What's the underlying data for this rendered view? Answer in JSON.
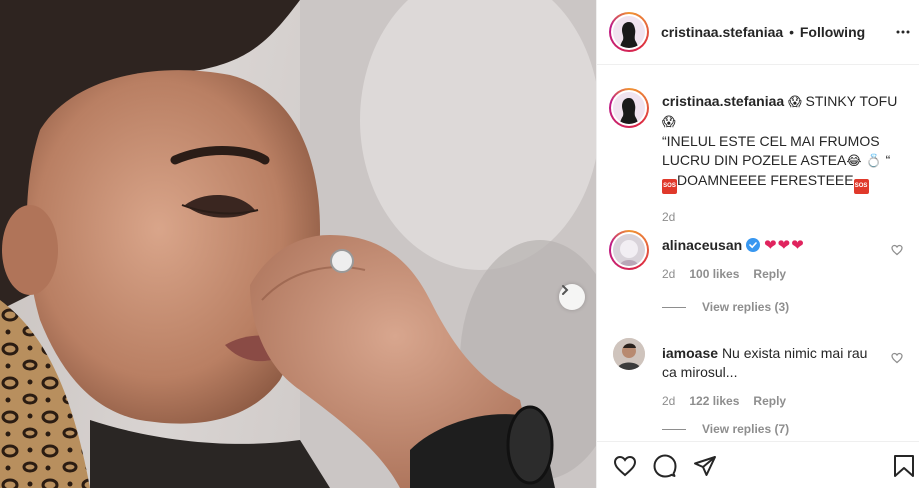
{
  "header": {
    "username": "cristinaa.stefaniaa",
    "separator": "•",
    "follow_state": "Following"
  },
  "caption": {
    "username": "cristinaa.stefaniaa",
    "emoji_scream": "😱",
    "title": "STINKY TOFU",
    "line2": "“INELUL ESTE CEL MAI FRUMOS LUCRU DIN POZELE ASTEA",
    "emoji_laugh": "😂",
    "emoji_ring": "💍",
    "quote_close": "“",
    "sos_label": "SOS",
    "line3": "DOAMNEEEE FERESTEEE",
    "time": "2d"
  },
  "comments": [
    {
      "username": "alinaceusan",
      "verified": true,
      "text": "❤❤❤",
      "time": "2d",
      "likes": "100 likes",
      "reply_label": "Reply",
      "view_replies": "View replies (3)"
    },
    {
      "username": "iamoase",
      "verified": false,
      "text": "Nu exista nimic mai rau ca mirosul...",
      "time": "2d",
      "likes": "122 likes",
      "reply_label": "Reply",
      "view_replies": "View replies (7)"
    }
  ],
  "icons": {
    "next": "chevron-right-icon",
    "like": "heart-icon",
    "comment": "comment-icon",
    "share": "paper-plane-icon",
    "save": "bookmark-icon",
    "more": "more-horizontal-icon"
  },
  "colors": {
    "accent_heart": "#e0245e",
    "verified": "#3897f0",
    "muted": "#8e8e8e",
    "text": "#262626",
    "divider": "#efefef"
  }
}
